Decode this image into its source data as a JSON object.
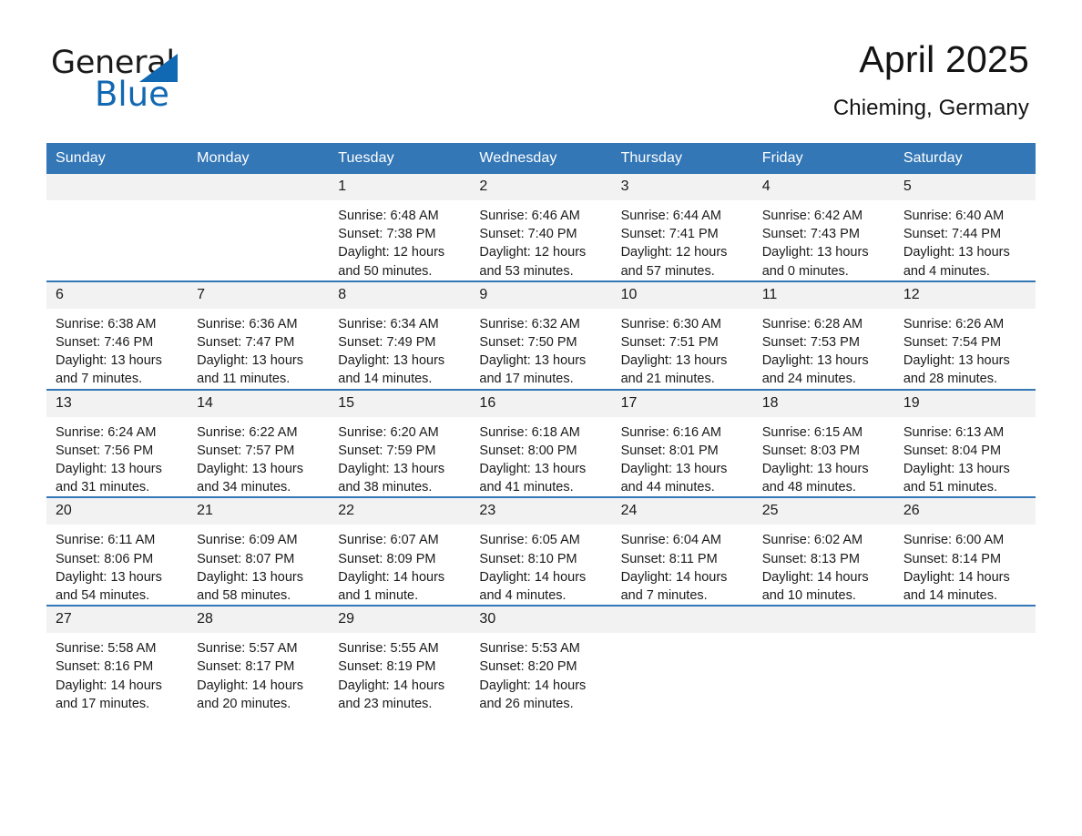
{
  "brand": {
    "logo_text_top": "General",
    "logo_text_bottom": "Blue",
    "logo_icon": "triangle-logo-icon",
    "accent_color": "#1168b3"
  },
  "header": {
    "title": "April 2025",
    "subtitle": "Chieming, Germany"
  },
  "theme": {
    "header_blue": "#3477b6",
    "row_divider_blue": "#3477b6",
    "daynum_bg": "#f2f2f2"
  },
  "calendar": {
    "weekday_headers": [
      "Sunday",
      "Monday",
      "Tuesday",
      "Wednesday",
      "Thursday",
      "Friday",
      "Saturday"
    ],
    "weeks": [
      [
        {
          "day": "",
          "blank": true,
          "sunrise": "",
          "sunset": "",
          "daylight_1": "",
          "daylight_2": ""
        },
        {
          "day": "",
          "blank": true,
          "sunrise": "",
          "sunset": "",
          "daylight_1": "",
          "daylight_2": ""
        },
        {
          "day": "1",
          "sunrise": "Sunrise: 6:48 AM",
          "sunset": "Sunset: 7:38 PM",
          "daylight_1": "Daylight: 12 hours",
          "daylight_2": "and 50 minutes."
        },
        {
          "day": "2",
          "sunrise": "Sunrise: 6:46 AM",
          "sunset": "Sunset: 7:40 PM",
          "daylight_1": "Daylight: 12 hours",
          "daylight_2": "and 53 minutes."
        },
        {
          "day": "3",
          "sunrise": "Sunrise: 6:44 AM",
          "sunset": "Sunset: 7:41 PM",
          "daylight_1": "Daylight: 12 hours",
          "daylight_2": "and 57 minutes."
        },
        {
          "day": "4",
          "sunrise": "Sunrise: 6:42 AM",
          "sunset": "Sunset: 7:43 PM",
          "daylight_1": "Daylight: 13 hours",
          "daylight_2": "and 0 minutes."
        },
        {
          "day": "5",
          "sunrise": "Sunrise: 6:40 AM",
          "sunset": "Sunset: 7:44 PM",
          "daylight_1": "Daylight: 13 hours",
          "daylight_2": "and 4 minutes."
        }
      ],
      [
        {
          "day": "6",
          "sunrise": "Sunrise: 6:38 AM",
          "sunset": "Sunset: 7:46 PM",
          "daylight_1": "Daylight: 13 hours",
          "daylight_2": "and 7 minutes."
        },
        {
          "day": "7",
          "sunrise": "Sunrise: 6:36 AM",
          "sunset": "Sunset: 7:47 PM",
          "daylight_1": "Daylight: 13 hours",
          "daylight_2": "and 11 minutes."
        },
        {
          "day": "8",
          "sunrise": "Sunrise: 6:34 AM",
          "sunset": "Sunset: 7:49 PM",
          "daylight_1": "Daylight: 13 hours",
          "daylight_2": "and 14 minutes."
        },
        {
          "day": "9",
          "sunrise": "Sunrise: 6:32 AM",
          "sunset": "Sunset: 7:50 PM",
          "daylight_1": "Daylight: 13 hours",
          "daylight_2": "and 17 minutes."
        },
        {
          "day": "10",
          "sunrise": "Sunrise: 6:30 AM",
          "sunset": "Sunset: 7:51 PM",
          "daylight_1": "Daylight: 13 hours",
          "daylight_2": "and 21 minutes."
        },
        {
          "day": "11",
          "sunrise": "Sunrise: 6:28 AM",
          "sunset": "Sunset: 7:53 PM",
          "daylight_1": "Daylight: 13 hours",
          "daylight_2": "and 24 minutes."
        },
        {
          "day": "12",
          "sunrise": "Sunrise: 6:26 AM",
          "sunset": "Sunset: 7:54 PM",
          "daylight_1": "Daylight: 13 hours",
          "daylight_2": "and 28 minutes."
        }
      ],
      [
        {
          "day": "13",
          "sunrise": "Sunrise: 6:24 AM",
          "sunset": "Sunset: 7:56 PM",
          "daylight_1": "Daylight: 13 hours",
          "daylight_2": "and 31 minutes."
        },
        {
          "day": "14",
          "sunrise": "Sunrise: 6:22 AM",
          "sunset": "Sunset: 7:57 PM",
          "daylight_1": "Daylight: 13 hours",
          "daylight_2": "and 34 minutes."
        },
        {
          "day": "15",
          "sunrise": "Sunrise: 6:20 AM",
          "sunset": "Sunset: 7:59 PM",
          "daylight_1": "Daylight: 13 hours",
          "daylight_2": "and 38 minutes."
        },
        {
          "day": "16",
          "sunrise": "Sunrise: 6:18 AM",
          "sunset": "Sunset: 8:00 PM",
          "daylight_1": "Daylight: 13 hours",
          "daylight_2": "and 41 minutes."
        },
        {
          "day": "17",
          "sunrise": "Sunrise: 6:16 AM",
          "sunset": "Sunset: 8:01 PM",
          "daylight_1": "Daylight: 13 hours",
          "daylight_2": "and 44 minutes."
        },
        {
          "day": "18",
          "sunrise": "Sunrise: 6:15 AM",
          "sunset": "Sunset: 8:03 PM",
          "daylight_1": "Daylight: 13 hours",
          "daylight_2": "and 48 minutes."
        },
        {
          "day": "19",
          "sunrise": "Sunrise: 6:13 AM",
          "sunset": "Sunset: 8:04 PM",
          "daylight_1": "Daylight: 13 hours",
          "daylight_2": "and 51 minutes."
        }
      ],
      [
        {
          "day": "20",
          "sunrise": "Sunrise: 6:11 AM",
          "sunset": "Sunset: 8:06 PM",
          "daylight_1": "Daylight: 13 hours",
          "daylight_2": "and 54 minutes."
        },
        {
          "day": "21",
          "sunrise": "Sunrise: 6:09 AM",
          "sunset": "Sunset: 8:07 PM",
          "daylight_1": "Daylight: 13 hours",
          "daylight_2": "and 58 minutes."
        },
        {
          "day": "22",
          "sunrise": "Sunrise: 6:07 AM",
          "sunset": "Sunset: 8:09 PM",
          "daylight_1": "Daylight: 14 hours",
          "daylight_2": "and 1 minute."
        },
        {
          "day": "23",
          "sunrise": "Sunrise: 6:05 AM",
          "sunset": "Sunset: 8:10 PM",
          "daylight_1": "Daylight: 14 hours",
          "daylight_2": "and 4 minutes."
        },
        {
          "day": "24",
          "sunrise": "Sunrise: 6:04 AM",
          "sunset": "Sunset: 8:11 PM",
          "daylight_1": "Daylight: 14 hours",
          "daylight_2": "and 7 minutes."
        },
        {
          "day": "25",
          "sunrise": "Sunrise: 6:02 AM",
          "sunset": "Sunset: 8:13 PM",
          "daylight_1": "Daylight: 14 hours",
          "daylight_2": "and 10 minutes."
        },
        {
          "day": "26",
          "sunrise": "Sunrise: 6:00 AM",
          "sunset": "Sunset: 8:14 PM",
          "daylight_1": "Daylight: 14 hours",
          "daylight_2": "and 14 minutes."
        }
      ],
      [
        {
          "day": "27",
          "sunrise": "Sunrise: 5:58 AM",
          "sunset": "Sunset: 8:16 PM",
          "daylight_1": "Daylight: 14 hours",
          "daylight_2": "and 17 minutes."
        },
        {
          "day": "28",
          "sunrise": "Sunrise: 5:57 AM",
          "sunset": "Sunset: 8:17 PM",
          "daylight_1": "Daylight: 14 hours",
          "daylight_2": "and 20 minutes."
        },
        {
          "day": "29",
          "sunrise": "Sunrise: 5:55 AM",
          "sunset": "Sunset: 8:19 PM",
          "daylight_1": "Daylight: 14 hours",
          "daylight_2": "and 23 minutes."
        },
        {
          "day": "30",
          "sunrise": "Sunrise: 5:53 AM",
          "sunset": "Sunset: 8:20 PM",
          "daylight_1": "Daylight: 14 hours",
          "daylight_2": "and 26 minutes."
        },
        {
          "day": "",
          "blank": true,
          "sunrise": "",
          "sunset": "",
          "daylight_1": "",
          "daylight_2": ""
        },
        {
          "day": "",
          "blank": true,
          "sunrise": "",
          "sunset": "",
          "daylight_1": "",
          "daylight_2": ""
        },
        {
          "day": "",
          "blank": true,
          "sunrise": "",
          "sunset": "",
          "daylight_1": "",
          "daylight_2": ""
        }
      ]
    ]
  }
}
